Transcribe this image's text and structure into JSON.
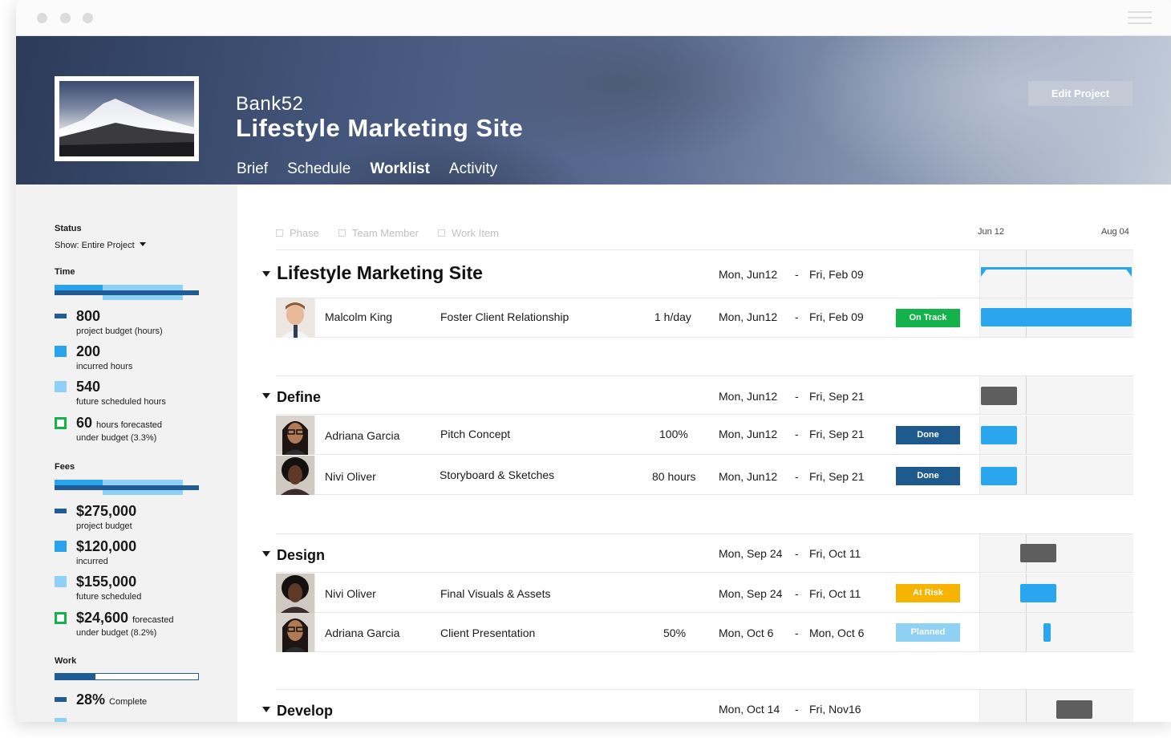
{
  "window": {
    "menu_icon": "hamburger-icon"
  },
  "header": {
    "client": "Bank52",
    "title": "Lifestyle Marketing Site",
    "tabs": [
      {
        "label": "Brief",
        "active": false
      },
      {
        "label": "Schedule",
        "active": false
      },
      {
        "label": "Worklist",
        "active": true
      },
      {
        "label": "Activity",
        "active": false
      }
    ],
    "edit_button": "Edit Project"
  },
  "sidebar": {
    "status_label": "Status",
    "show_label": "Show: Entire Project",
    "time": {
      "label": "Time",
      "stats": [
        {
          "value": "800",
          "label": "project budget (hours)"
        },
        {
          "value": "200",
          "label": "incurred hours"
        },
        {
          "value": "540",
          "label": "future scheduled hours"
        },
        {
          "value": "60",
          "suffix": "hours forecasted",
          "label": "under budget (3.3%)"
        }
      ]
    },
    "fees": {
      "label": "Fees",
      "stats": [
        {
          "value": "$275,000",
          "label": "project budget"
        },
        {
          "value": "$120,000",
          "label": "incurred"
        },
        {
          "value": "$155,000",
          "label": "future scheduled"
        },
        {
          "value": "$24,600",
          "suffix": "forecasted",
          "label": "under budget (8.2%)"
        }
      ]
    },
    "work": {
      "label": "Work",
      "complete_value": "28%",
      "complete_label": "Complete",
      "complete_fraction": 0.28
    }
  },
  "worklist": {
    "filters": [
      "Phase",
      "Team Member",
      "Work Item"
    ],
    "timeline_start": "Jun 12",
    "timeline_end": "Aug 04",
    "project": {
      "name": "Lifestyle Marketing Site",
      "start": "Mon, Jun12",
      "end": "Fri, Feb 09"
    },
    "rows": {
      "r1": {
        "person": "Malcolm King",
        "task": "Foster Client Relationship",
        "effort": "1 h/day",
        "start": "Mon, Jun12",
        "end": "Fri, Feb 09",
        "status": "On Track"
      },
      "r2": {
        "person": "Adriana Garcia",
        "task": "Pitch Concept",
        "effort": "100%",
        "start": "Mon, Jun12",
        "end": "Fri, Sep 21",
        "status": "Done"
      },
      "r3": {
        "person": "Nivi Oliver",
        "task": "Storyboard & Sketches",
        "effort": "80 hours",
        "start": "Mon, Jun12",
        "end": "Fri, Sep 21",
        "status": "Done"
      },
      "r4": {
        "person": "Nivi Oliver",
        "task": "Final Visuals & Assets",
        "effort": "",
        "start": "Mon, Sep 24",
        "end": "Fri, Oct 11",
        "status": "At Risk"
      },
      "r5": {
        "person": "Adriana Garcia",
        "task": "Client Presentation",
        "effort": "50%",
        "start": "Mon, Oct 6",
        "end": "Mon, Oct 6",
        "status": "Planned"
      }
    },
    "phases": {
      "define": {
        "name": "Define",
        "start": "Mon, Jun12",
        "end": "Fri, Sep 21"
      },
      "design": {
        "name": "Design",
        "start": "Mon, Sep 24",
        "end": "Fri, Oct 11"
      },
      "develop": {
        "name": "Develop",
        "start": "Mon, Oct 14",
        "end": "Fri, Nov16"
      }
    },
    "dash": "-"
  },
  "colors": {
    "on_track": "#13b24b",
    "done": "#1f5a8f",
    "at_risk": "#f6b400",
    "planned": "#8fd0f5",
    "gantt_task": "#2aa6ee",
    "gantt_phase": "#5e5e5e"
  }
}
